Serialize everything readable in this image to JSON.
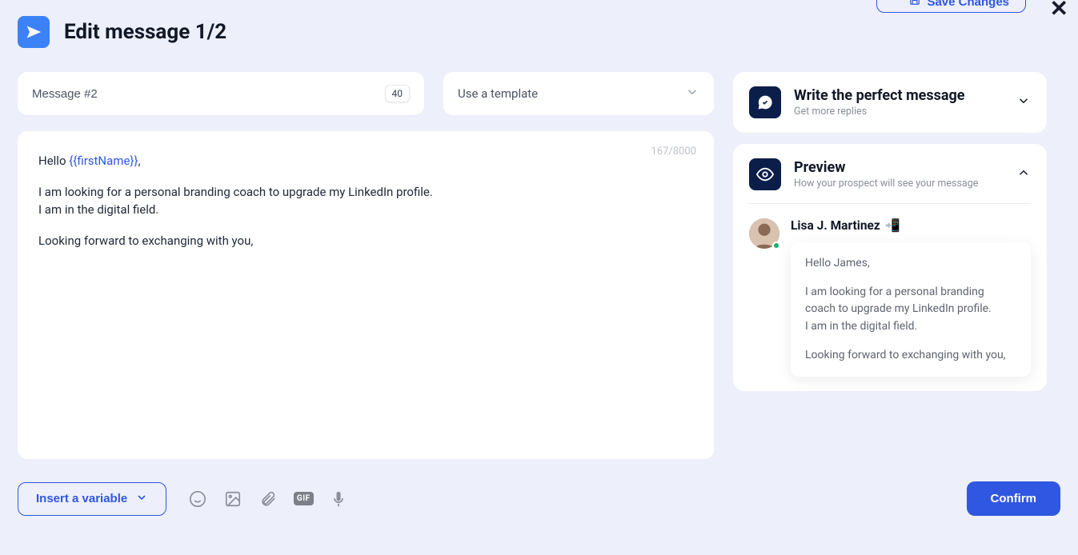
{
  "topbar": {
    "save_label": "Save Changes"
  },
  "header": {
    "title": "Edit message 1/2"
  },
  "nameField": {
    "value": "Message #2",
    "limit": "40"
  },
  "templateSelect": {
    "placeholder": "Use a template"
  },
  "editor": {
    "counter": "167/8000",
    "greeting_prefix": "Hello ",
    "variable_token": "{{firstName}}",
    "greeting_suffix": ",",
    "line2": "I am looking for a personal branding coach to upgrade my LinkedIn profile.",
    "line3": "I am in the digital field.",
    "line4": "Looking forward to exchanging with you,"
  },
  "toolbar": {
    "insert_label": "Insert a variable",
    "gif_label": "GIF"
  },
  "confirm": {
    "label": "Confirm"
  },
  "perfectCard": {
    "title": "Write the perfect message",
    "sub": "Get more replies"
  },
  "previewCard": {
    "title": "Preview",
    "sub": "How your prospect will see your message",
    "prospect_name": "Lisa J. Martinez",
    "prospect_emoji": "📲",
    "msg_l1": "Hello James,",
    "msg_l2": "I am looking for a personal branding coach to upgrade my LinkedIn profile.",
    "msg_l3": "I am in the digital field.",
    "msg_l4": "Looking forward to exchanging with you,"
  }
}
